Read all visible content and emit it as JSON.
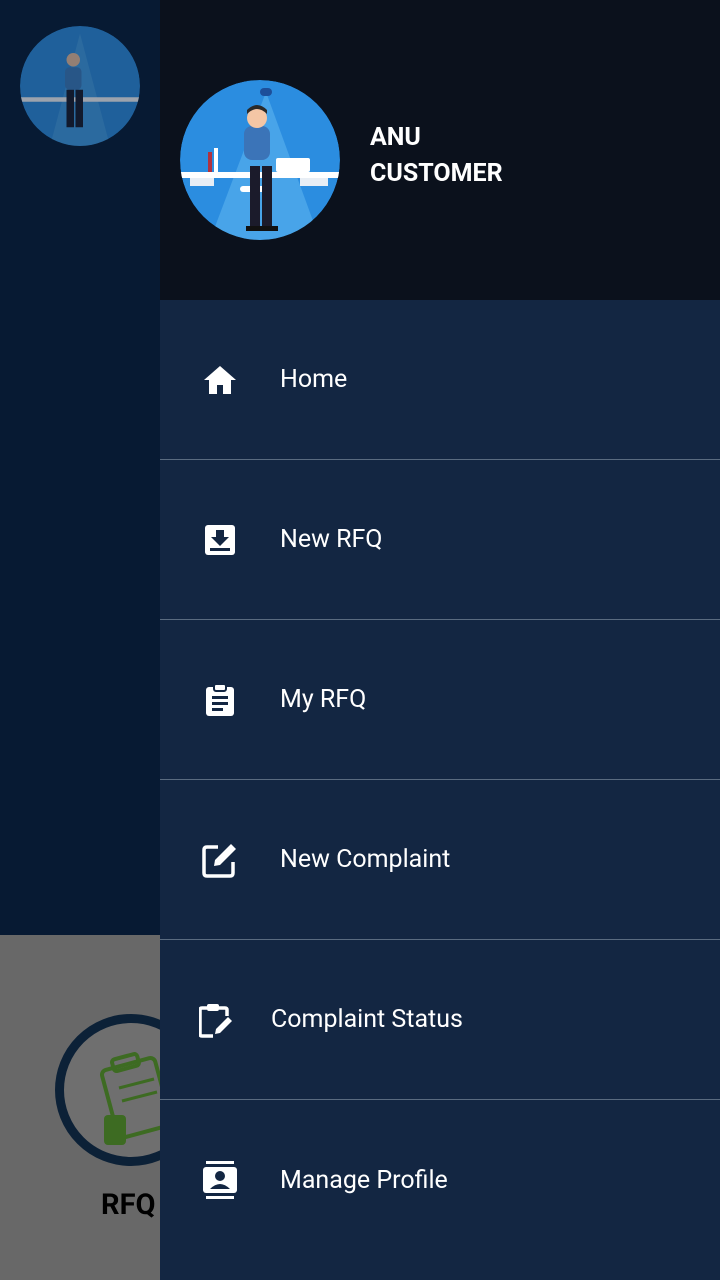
{
  "user": {
    "name": "ANU",
    "role": "CUSTOMER"
  },
  "background": {
    "card_label": "RFQ"
  },
  "menu": {
    "items": [
      {
        "label": "Home",
        "icon": "home-icon"
      },
      {
        "label": "New RFQ",
        "icon": "inbox-download-icon"
      },
      {
        "label": "My RFQ",
        "icon": "clipboard-text-icon"
      },
      {
        "label": "New Complaint",
        "icon": "edit-square-icon"
      },
      {
        "label": "Complaint Status",
        "icon": "clipboard-edit-icon"
      },
      {
        "label": "Manage Profile",
        "icon": "contact-card-icon"
      }
    ]
  },
  "colors": {
    "drawer_bg": "#132642",
    "header_bg": "#0b111c",
    "app_bg": "#071a33",
    "divider": "#5a6b80",
    "text": "#ffffff"
  }
}
